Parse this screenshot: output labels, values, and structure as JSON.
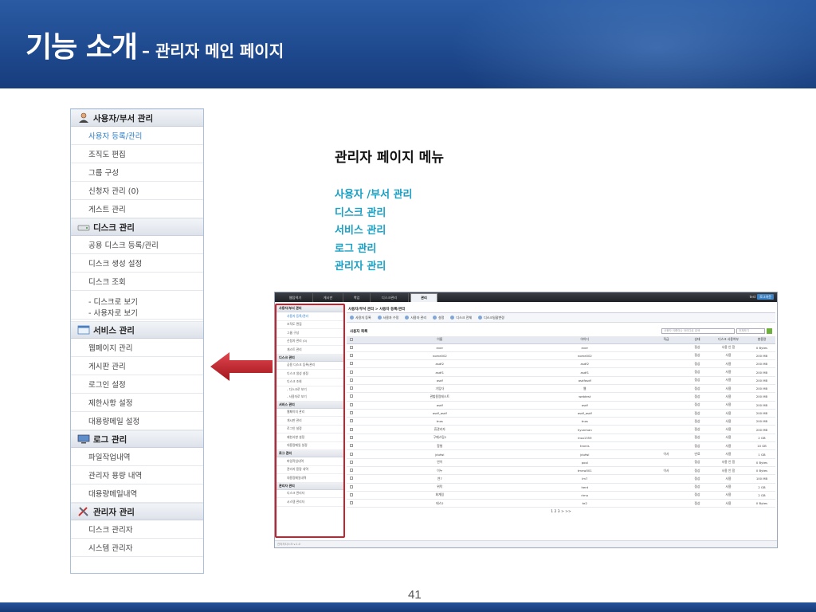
{
  "slide": {
    "title_main": "기능 소개",
    "title_sub": "– 관리자 메인 페이지",
    "page_number": "41"
  },
  "menu": {
    "sections": [
      {
        "label": "사용자/부서 관리",
        "icon": "user-icon",
        "items": [
          "사용자 등록/관리",
          "조직도 편집",
          "그룹 구성",
          "신청자 관리 (0)",
          "게스트 관리"
        ]
      },
      {
        "label": "디스크 관리",
        "icon": "disk-icon",
        "items": [
          "공용 디스크 등록/관리",
          "디스크 생성 설정",
          "디스크 조회"
        ],
        "subitems": [
          "- 디스크로 보기",
          "- 사용자로 보기"
        ]
      },
      {
        "label": "서비스 관리",
        "icon": "window-icon",
        "items": [
          "웹페이지 관리",
          "게시판 관리",
          "로그인 설정",
          "제한사항 설정",
          "대용량메일 설정"
        ]
      },
      {
        "label": "로그 관리",
        "icon": "monitor-icon",
        "items": [
          "파일작업내역",
          "관리자 용량 내역",
          "대용량메일내역"
        ]
      },
      {
        "label": "관리자 관리",
        "icon": "tools-icon",
        "items": [
          "디스크 관리자",
          "시스템 관리자"
        ]
      }
    ]
  },
  "center": {
    "title": "관리자 페이지 메뉴",
    "list": [
      "사용자 /부서 관리",
      "디스크 관리",
      "서비스 관리",
      "로그 관리",
      "관리자 관리"
    ]
  },
  "colors": {
    "header": "#1f4a8f",
    "accent_text": "#1aa0c4",
    "arrow": "#c9202b",
    "highlight_box": "#c9202b",
    "active_item": "#2c7ec9"
  },
  "screenshot": {
    "tabs": [
      "웹탐색기",
      "게시판",
      "백업",
      "디스크관리",
      "관리"
    ],
    "active_tab": "관리",
    "user": "test",
    "logout": "로그아웃",
    "breadcrumb": "사용자/부서 관리 > 사용자 등록/관리",
    "actions": [
      "사용자 등록",
      "사용자 수정",
      "사용자 관리",
      "설정",
      "디스크 전체",
      "디스크일괄변경"
    ],
    "list_label": "사용자 목록",
    "search_placeholder": "사용자 이름이나 아이디로 검색",
    "select_placeholder": "전체보기",
    "side": [
      {
        "label": "사용자/부서 관리",
        "items": [
          "사용자 등록/관리",
          "조직도 편집",
          "그룹 구성",
          "신청자 관리 (0)",
          "게스트 관리"
        ]
      },
      {
        "label": "디스크 관리",
        "items": [
          "공용 디스크 등록/관리",
          "디스크 생성 설정",
          "디스크 조회",
          "- 디스크로 보기",
          "- 사용자로 보기"
        ]
      },
      {
        "label": "서비스 관리",
        "items": [
          "웹페이지 관리",
          "게시판 관리",
          "로그인 설정",
          "제한사항 설정",
          "대용량메일 설정"
        ]
      },
      {
        "label": "로그 관리",
        "items": [
          "파일작업내역",
          "관리자 용량 내역",
          "대용량메일내역"
        ]
      },
      {
        "label": "관리자 관리",
        "items": [
          "디스크 관리자",
          "시스템 관리자"
        ]
      }
    ],
    "columns": [
      "",
      "이름",
      "아이디",
      "직급",
      "상태",
      "디스크 사용여부",
      "총용량"
    ],
    "rows": [
      [
        "ever",
        "ever",
        "",
        "정상",
        "사용 안 함",
        "0 Bytes"
      ],
      [
        "nome002",
        "nome002",
        "",
        "정상",
        "사용",
        "200 MB"
      ],
      [
        "asdf2",
        "asdf2",
        "",
        "정상",
        "사용",
        "200 MB"
      ],
      [
        "asdf1",
        "asdf1",
        "",
        "정상",
        "사용",
        "200 MB"
      ],
      [
        "asdf",
        "asdfasdf",
        "",
        "정상",
        "사용",
        "200 MB"
      ],
      [
        "가입자",
        "웹",
        "",
        "정상",
        "사용",
        "200 MB"
      ],
      [
        "관할용량테스트",
        "webtest",
        "",
        "정상",
        "사용",
        "200 MB"
      ],
      [
        "asdf",
        "asdf",
        "",
        "정상",
        "사용",
        "200 MB"
      ],
      [
        "asdf_asdf",
        "asdf_asdf",
        "",
        "정상",
        "사용",
        "200 MB"
      ],
      [
        "tnos",
        "tnos",
        "",
        "정상",
        "사용",
        "200 MB"
      ],
      [
        "휴관리자",
        "hyunman",
        "",
        "정상",
        "사용",
        "200 MB"
      ],
      [
        "구매스팀2",
        "lnsa1359",
        "",
        "정상",
        "사용",
        "2 GB"
      ],
      [
        "함형",
        "tnxnis",
        "",
        "정상",
        "사용",
        "10 GB"
      ],
      [
        "jdufwl",
        "jdufwl",
        "이사",
        "만료",
        "사용",
        "1 GB"
      ],
      [
        "연이",
        "pool",
        "",
        "정상",
        "사용 안 함",
        "0 Bytes"
      ],
      [
        "이누",
        "tmnw001",
        "이사",
        "정상",
        "사용 안 함",
        "0 Bytes"
      ],
      [
        "연7",
        "lm7",
        "",
        "정상",
        "사용",
        "100 MB"
      ],
      [
        "위탁",
        "hent",
        "",
        "정상",
        "사용",
        "2 GB"
      ],
      [
        "회계림",
        "rimu",
        "",
        "정상",
        "사용",
        "2 GB"
      ],
      [
        "테스2",
        "te2",
        "",
        "정상",
        "사용",
        "0 Bytes"
      ]
    ],
    "pager": "1 2 3 > >>",
    "footer": "관리자디스크 v.1.0"
  }
}
